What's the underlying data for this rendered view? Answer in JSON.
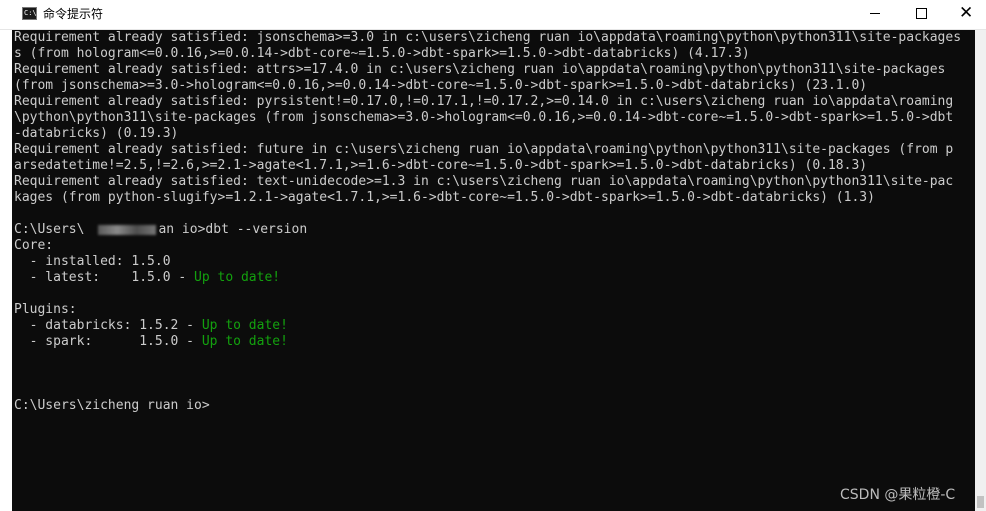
{
  "window": {
    "title": "命令提示符",
    "icon": "cmd-icon",
    "icon_glyph": "C:\\"
  },
  "controls": {
    "minimize": "minimize-icon",
    "maximize": "maximize-icon",
    "close": "close-icon",
    "close_glyph": "✕"
  },
  "console": {
    "lines": [
      {
        "segments": [
          {
            "text": "Requirement already satisfied: jsonschema>=3.0 in c:\\users\\zicheng ruan io\\appdata\\roaming\\python\\python311\\site-packages"
          }
        ]
      },
      {
        "segments": [
          {
            "text": "s (from hologram<=0.0.16,>=0.0.14->dbt-core~=1.5.0->dbt-spark>=1.5.0->dbt-databricks) (4.17.3)"
          }
        ]
      },
      {
        "segments": [
          {
            "text": "Requirement already satisfied: attrs>=17.4.0 in c:\\users\\zicheng ruan io\\appdata\\roaming\\python\\python311\\site-packages"
          }
        ]
      },
      {
        "segments": [
          {
            "text": "(from jsonschema>=3.0->hologram<=0.0.16,>=0.0.14->dbt-core~=1.5.0->dbt-spark>=1.5.0->dbt-databricks) (23.1.0)"
          }
        ]
      },
      {
        "segments": [
          {
            "text": "Requirement already satisfied: pyrsistent!=0.17.0,!=0.17.1,!=0.17.2,>=0.14.0 in c:\\users\\zicheng ruan io\\appdata\\roaming"
          }
        ]
      },
      {
        "segments": [
          {
            "text": "\\python\\python311\\site-packages (from jsonschema>=3.0->hologram<=0.0.16,>=0.0.14->dbt-core~=1.5.0->dbt-spark>=1.5.0->dbt"
          }
        ]
      },
      {
        "segments": [
          {
            "text": "-databricks) (0.19.3)"
          }
        ]
      },
      {
        "segments": [
          {
            "text": "Requirement already satisfied: future in c:\\users\\zicheng ruan io\\appdata\\roaming\\python\\python311\\site-packages (from p"
          }
        ]
      },
      {
        "segments": [
          {
            "text": "arsedatetime!=2.5,!=2.6,>=2.1->agate<1.7.1,>=1.6->dbt-core~=1.5.0->dbt-spark>=1.5.0->dbt-databricks) (0.18.3)"
          }
        ]
      },
      {
        "segments": [
          {
            "text": "Requirement already satisfied: text-unidecode>=1.3 in c:\\users\\zicheng ruan io\\appdata\\roaming\\python\\python311\\site-pac"
          }
        ]
      },
      {
        "segments": [
          {
            "text": "kages (from python-slugify>=1.2.1->agate<1.7.1,>=1.6->dbt-core~=1.5.0->dbt-spark>=1.5.0->dbt-databricks) (1.3)"
          }
        ]
      },
      {
        "segments": [
          {
            "text": ""
          }
        ]
      },
      {
        "segments": [
          {
            "text": "C:\\Users\\"
          },
          {
            "blur": true
          },
          {
            "text": "an io>dbt --version"
          }
        ]
      },
      {
        "segments": [
          {
            "text": "Core:"
          }
        ]
      },
      {
        "segments": [
          {
            "text": "  - installed: 1.5.0"
          }
        ]
      },
      {
        "segments": [
          {
            "text": "  - latest:    1.5.0 - "
          },
          {
            "text": "Up to date!",
            "color": "green"
          }
        ]
      },
      {
        "segments": [
          {
            "text": ""
          }
        ]
      },
      {
        "segments": [
          {
            "text": "Plugins:"
          }
        ]
      },
      {
        "segments": [
          {
            "text": "  - databricks: 1.5.2 - "
          },
          {
            "text": "Up to date!",
            "color": "green"
          }
        ]
      },
      {
        "segments": [
          {
            "text": "  - spark:      1.5.0 - "
          },
          {
            "text": "Up to date!",
            "color": "green"
          }
        ]
      },
      {
        "segments": [
          {
            "text": ""
          }
        ]
      },
      {
        "segments": [
          {
            "text": ""
          }
        ]
      },
      {
        "segments": [
          {
            "text": ""
          }
        ]
      },
      {
        "segments": [
          {
            "text": "C:\\Users\\zicheng ruan io>"
          }
        ]
      }
    ]
  },
  "watermark": "CSDN @果粒橙-C",
  "colors": {
    "console_bg": "#0c0c0c",
    "console_fg": "#cccccc",
    "up_to_date": "#13a10e"
  }
}
